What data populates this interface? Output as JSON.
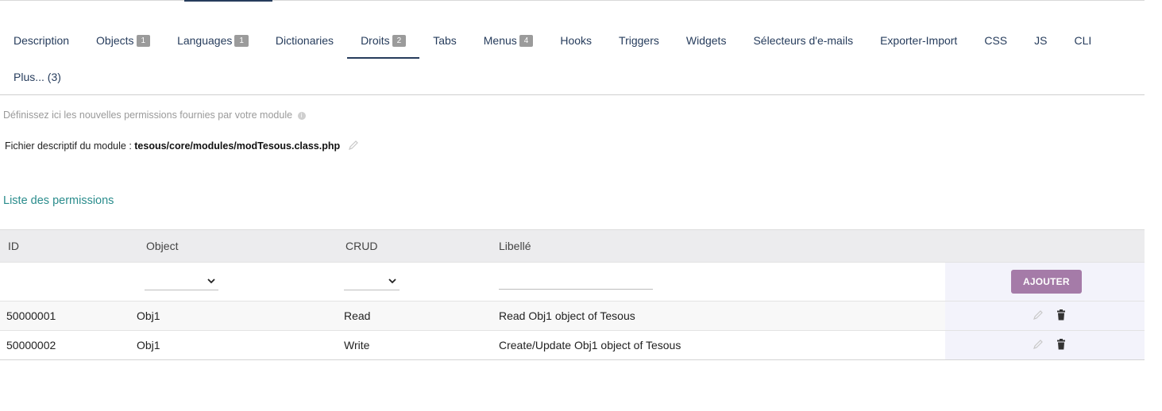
{
  "tabs": [
    {
      "label": "Description",
      "badge": null,
      "active": false
    },
    {
      "label": "Objects",
      "badge": "1",
      "active": false
    },
    {
      "label": "Languages",
      "badge": "1",
      "active": false
    },
    {
      "label": "Dictionaries",
      "badge": null,
      "active": false
    },
    {
      "label": "Droits",
      "badge": "2",
      "active": true
    },
    {
      "label": "Tabs",
      "badge": null,
      "active": false
    },
    {
      "label": "Menus",
      "badge": "4",
      "active": false
    },
    {
      "label": "Hooks",
      "badge": null,
      "active": false
    },
    {
      "label": "Triggers",
      "badge": null,
      "active": false
    },
    {
      "label": "Widgets",
      "badge": null,
      "active": false
    },
    {
      "label": "Sélecteurs d'e-mails",
      "badge": null,
      "active": false
    },
    {
      "label": "Exporter-Import",
      "badge": null,
      "active": false
    },
    {
      "label": "CSS",
      "badge": null,
      "active": false
    },
    {
      "label": "JS",
      "badge": null,
      "active": false
    },
    {
      "label": "CLI",
      "badge": null,
      "active": false
    }
  ],
  "more_tab": "Plus... (3)",
  "description": "Définissez ici les nouvelles permissions fournies par votre module",
  "file": {
    "label": "Fichier descriptif du module : ",
    "path": "tesous/core/modules/modTesous.class.php"
  },
  "section_title": "Liste des permissions",
  "table": {
    "headers": {
      "id": "ID",
      "object": "Object",
      "crud": "CRUD",
      "label": "Libellé"
    },
    "add_button": "AJOUTER",
    "rows": [
      {
        "id": "50000001",
        "object": "Obj1",
        "crud": "Read",
        "label": "Read Obj1 object of Tesous"
      },
      {
        "id": "50000002",
        "object": "Obj1",
        "crud": "Write",
        "label": "Create/Update Obj1 object of Tesous"
      }
    ]
  },
  "colors": {
    "tab_text": "#263c5c",
    "section_title": "#2a8c8c",
    "add_button": "#a57ba8",
    "badge": "#9b9b9b"
  },
  "icons": [
    "info-icon",
    "pencil-icon",
    "edit-icon",
    "trash-icon",
    "chevron-down-icon"
  ]
}
